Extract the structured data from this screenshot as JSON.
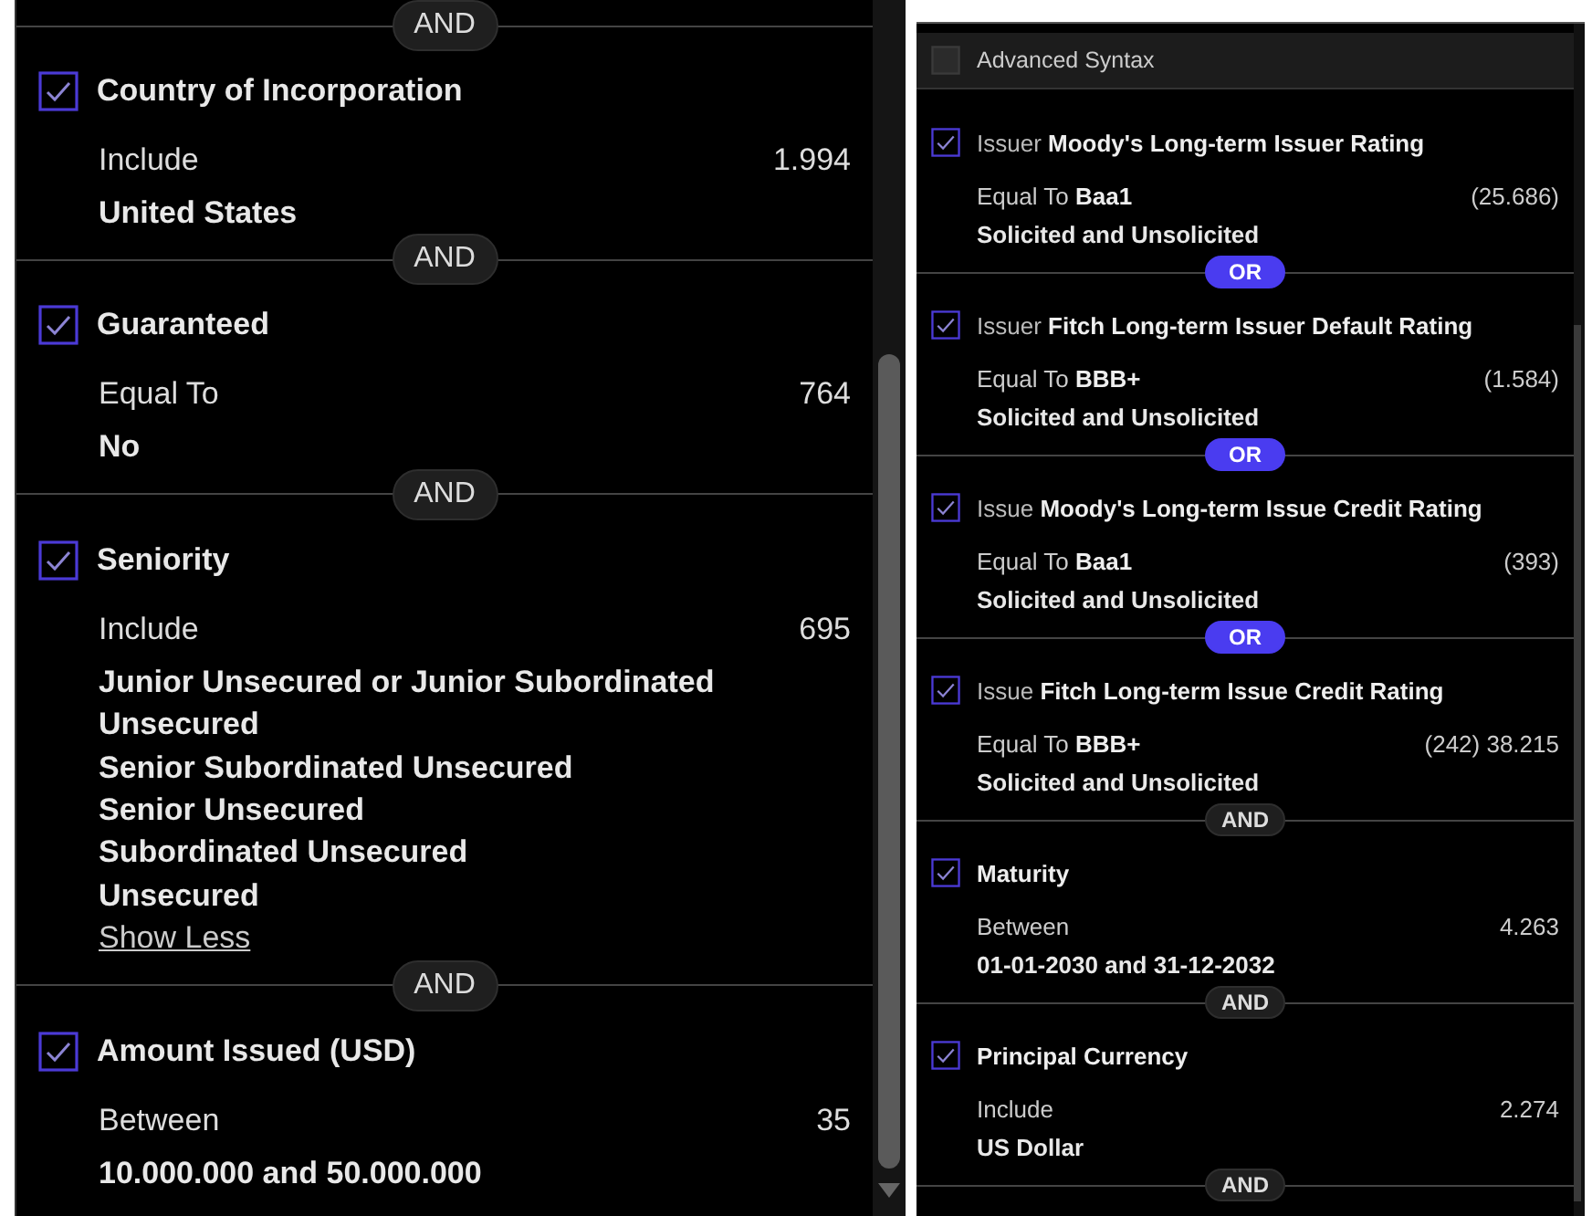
{
  "left_panel": {
    "top_connector": {
      "label": "AND",
      "kind": "and"
    },
    "criteria": [
      {
        "checked": true,
        "title": "Country of Incorporation",
        "condition": "Include",
        "count": "1.994",
        "values": [
          "United States"
        ],
        "connector": {
          "label": "AND",
          "kind": "and"
        }
      },
      {
        "checked": true,
        "title": "Guaranteed",
        "condition": "Equal To",
        "count": "764",
        "values": [
          "No"
        ],
        "connector": {
          "label": "AND",
          "kind": "and"
        }
      },
      {
        "checked": true,
        "title": "Seniority",
        "condition": "Include",
        "count": "695",
        "values": [
          "Junior Unsecured or Junior Subordinated Unsecured",
          "Senior Subordinated Unsecured",
          "Senior Unsecured",
          "Subordinated Unsecured",
          "Unsecured"
        ],
        "link": "Show Less",
        "connector": {
          "label": "AND",
          "kind": "and"
        }
      },
      {
        "checked": true,
        "title": "Amount Issued (USD)",
        "condition": "Between",
        "count": "35",
        "values": [
          "10.000.000 and 50.000.000"
        ]
      }
    ]
  },
  "right_panel": {
    "advanced_syntax": {
      "label": "Advanced Syntax",
      "checked": false
    },
    "criteria": [
      {
        "checked": true,
        "title": "Issuer **Moody's Long-term Issuer Rating**",
        "condition": "Equal To **Baa1**",
        "count": "(25.686)",
        "values": [
          "Solicited and Unsolicited"
        ],
        "connector": {
          "label": "OR",
          "kind": "or"
        }
      },
      {
        "checked": true,
        "title": "Issuer **Fitch Long-term Issuer Default Rating**",
        "condition": "Equal To **BBB+**",
        "count": "(1.584)",
        "values": [
          "Solicited and Unsolicited"
        ],
        "connector": {
          "label": "OR",
          "kind": "or"
        }
      },
      {
        "checked": true,
        "title": "Issue **Moody's Long-term Issue Credit Rating**",
        "condition": "Equal To **Baa1**",
        "count": "(393)",
        "values": [
          "Solicited and Unsolicited"
        ],
        "connector": {
          "label": "OR",
          "kind": "or"
        }
      },
      {
        "checked": true,
        "title": "Issue **Fitch Long-term Issue Credit Rating**",
        "condition": "Equal To **BBB+**",
        "count": "(242) 38.215",
        "values": [
          "Solicited and Unsolicited"
        ],
        "connector": {
          "label": "AND",
          "kind": "and"
        }
      },
      {
        "checked": true,
        "title": "**Maturity**",
        "condition": "Between",
        "count": "4.263",
        "values": [
          "01-01-2030 and 31-12-2032"
        ],
        "connector": {
          "label": "AND",
          "kind": "and"
        }
      },
      {
        "checked": true,
        "title": "**Principal Currency**",
        "condition": "Include",
        "count": "2.274",
        "values": [
          "US Dollar"
        ],
        "connector": {
          "label": "AND",
          "kind": "and"
        }
      }
    ]
  }
}
